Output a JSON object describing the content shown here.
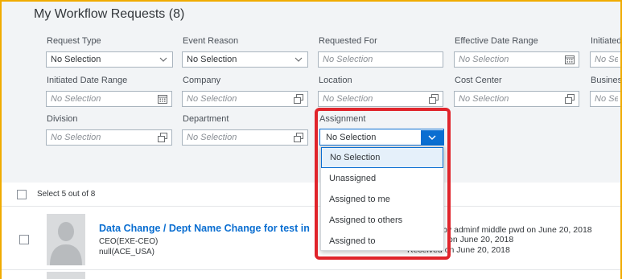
{
  "page": {
    "title": "My Workflow Requests (8)"
  },
  "filters": {
    "request_type": {
      "label": "Request Type",
      "value": "No Selection"
    },
    "event_reason": {
      "label": "Event Reason",
      "value": "No Selection"
    },
    "requested_for": {
      "label": "Requested For",
      "placeholder": "No Selection"
    },
    "effective_date_range": {
      "label": "Effective Date Range",
      "placeholder": "No Selection"
    },
    "initiated_by": {
      "label": "Initiated",
      "placeholder": "No Se"
    },
    "initiated_date_range": {
      "label": "Initiated Date Range",
      "placeholder": "No Selection"
    },
    "company": {
      "label": "Company",
      "placeholder": "No Selection"
    },
    "location": {
      "label": "Location",
      "placeholder": "No Selection"
    },
    "cost_center": {
      "label": "Cost Center",
      "placeholder": "No Selection"
    },
    "business": {
      "label": "Busines",
      "placeholder": "No Sel"
    },
    "division": {
      "label": "Division",
      "placeholder": "No Selection"
    },
    "department": {
      "label": "Department",
      "placeholder": "No Selection"
    },
    "assignment": {
      "label": "Assignment",
      "value": "No Selection"
    }
  },
  "assignment_dropdown": {
    "options": [
      "No Selection",
      "Unassigned",
      "Assigned to me",
      "Assigned to others",
      "Assigned to"
    ],
    "selected_index": 0
  },
  "selection": {
    "text": "Select 5 out of 8"
  },
  "request_item": {
    "title": "Data Change / Dept Name Change for test in",
    "line1": "CEO(EXE-CEO)",
    "line2": "null(ACE_USA)",
    "meta1": "by adminf middle pwd on June 20, 2018",
    "meta2": "on June 20, 2018",
    "meta3": "Received on June 20, 2018"
  },
  "colors": {
    "accent": "#0a6ed1",
    "highlight": "#e0242b",
    "frame": "#f0ab00"
  }
}
